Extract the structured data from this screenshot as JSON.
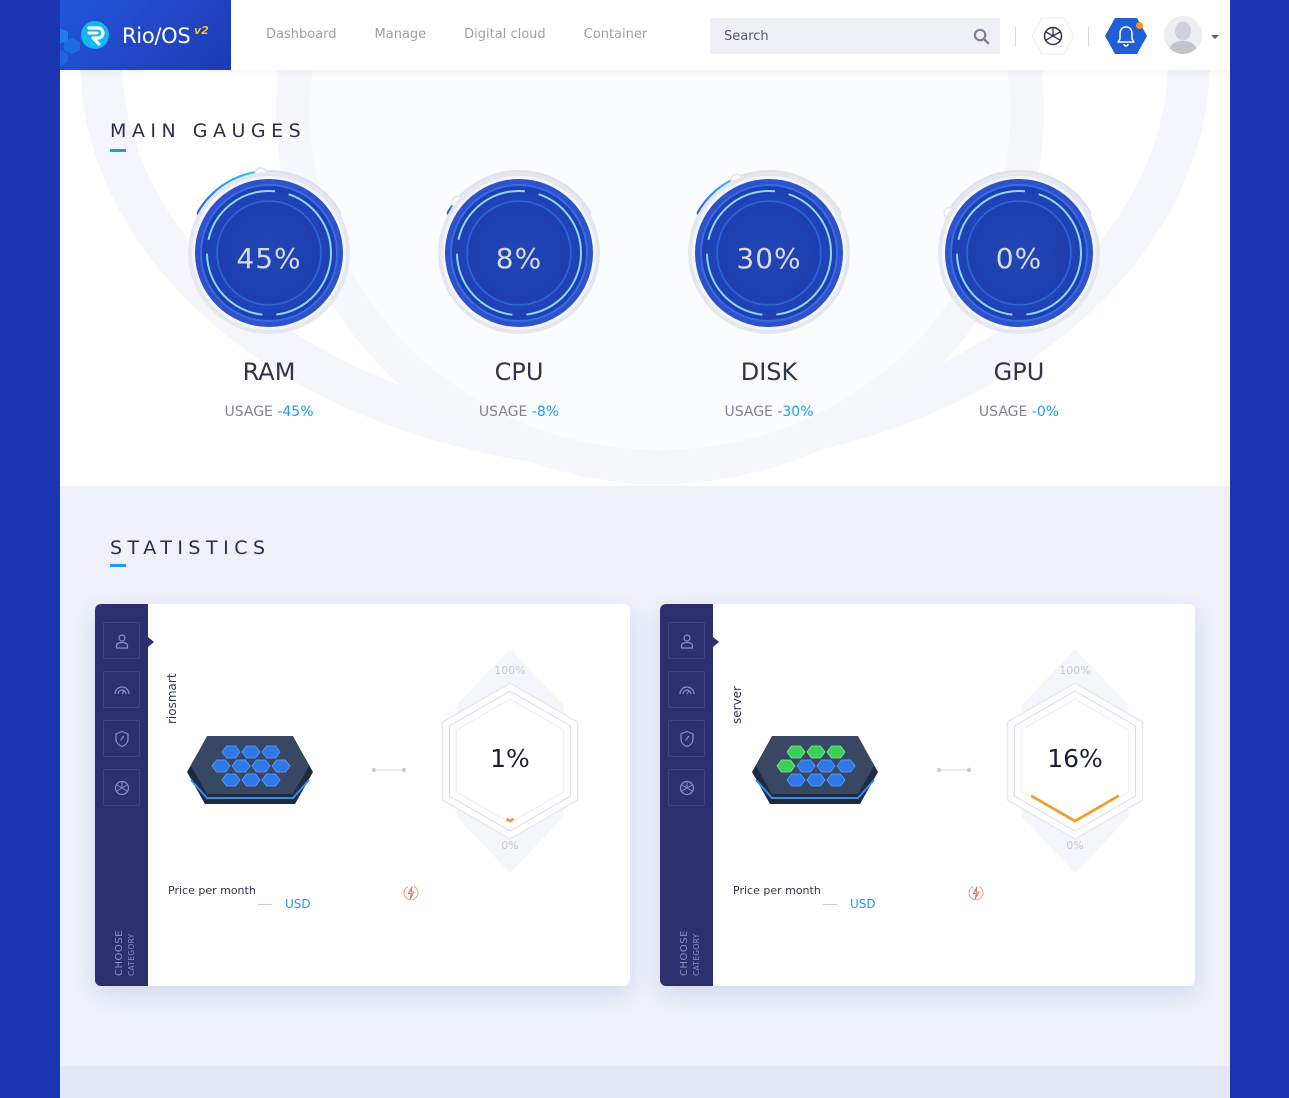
{
  "brand": {
    "name": "Rio/OS",
    "version": "v2"
  },
  "nav": [
    {
      "label": "Dashboard"
    },
    {
      "label": "Manage"
    },
    {
      "label": "Digital cloud"
    },
    {
      "label": "Container"
    }
  ],
  "search": {
    "placeholder": "Search",
    "value": ""
  },
  "header_icons": {
    "cube": "cube-icon",
    "bell": "bell-icon",
    "avatar": "user-avatar"
  },
  "colors": {
    "page_bg": "#1b35b2",
    "accent": "#1e9bf0",
    "gauge_core": "#1d3fb4",
    "sidebar": "#2d306f",
    "notification": "#f6922a"
  },
  "main_gauges": {
    "title": "MAIN GAUGES",
    "usage_prefix": "USAGE",
    "items": [
      {
        "name": "RAM",
        "percent_text": "45%",
        "usage_text": "-45%",
        "percent": 45
      },
      {
        "name": "CPU",
        "percent_text": "8%",
        "usage_text": "-8%",
        "percent": 8
      },
      {
        "name": "DISK",
        "percent_text": "30%",
        "usage_text": "-30%",
        "percent": 30
      },
      {
        "name": "GPU",
        "percent_text": "0%",
        "usage_text": "-0%",
        "percent": 0
      }
    ]
  },
  "statistics": {
    "title": "STATISTICS",
    "choose_label_1": "CHOOSE",
    "choose_label_2": "CATEGORY",
    "side_icons": [
      "user-icon",
      "speedometer-icon",
      "shield-icon",
      "cube-icon"
    ],
    "cards": [
      {
        "name": "riosmart",
        "percent_text": "1%",
        "percent": 1,
        "max_label": "100%",
        "min_label": "0%",
        "price_label": "Price per month",
        "currency": "USD",
        "tiles_active": 0
      },
      {
        "name": "server",
        "percent_text": "16%",
        "percent": 16,
        "max_label": "100%",
        "min_label": "0%",
        "price_label": "Price per month",
        "currency": "USD",
        "tiles_active": 4
      }
    ]
  }
}
